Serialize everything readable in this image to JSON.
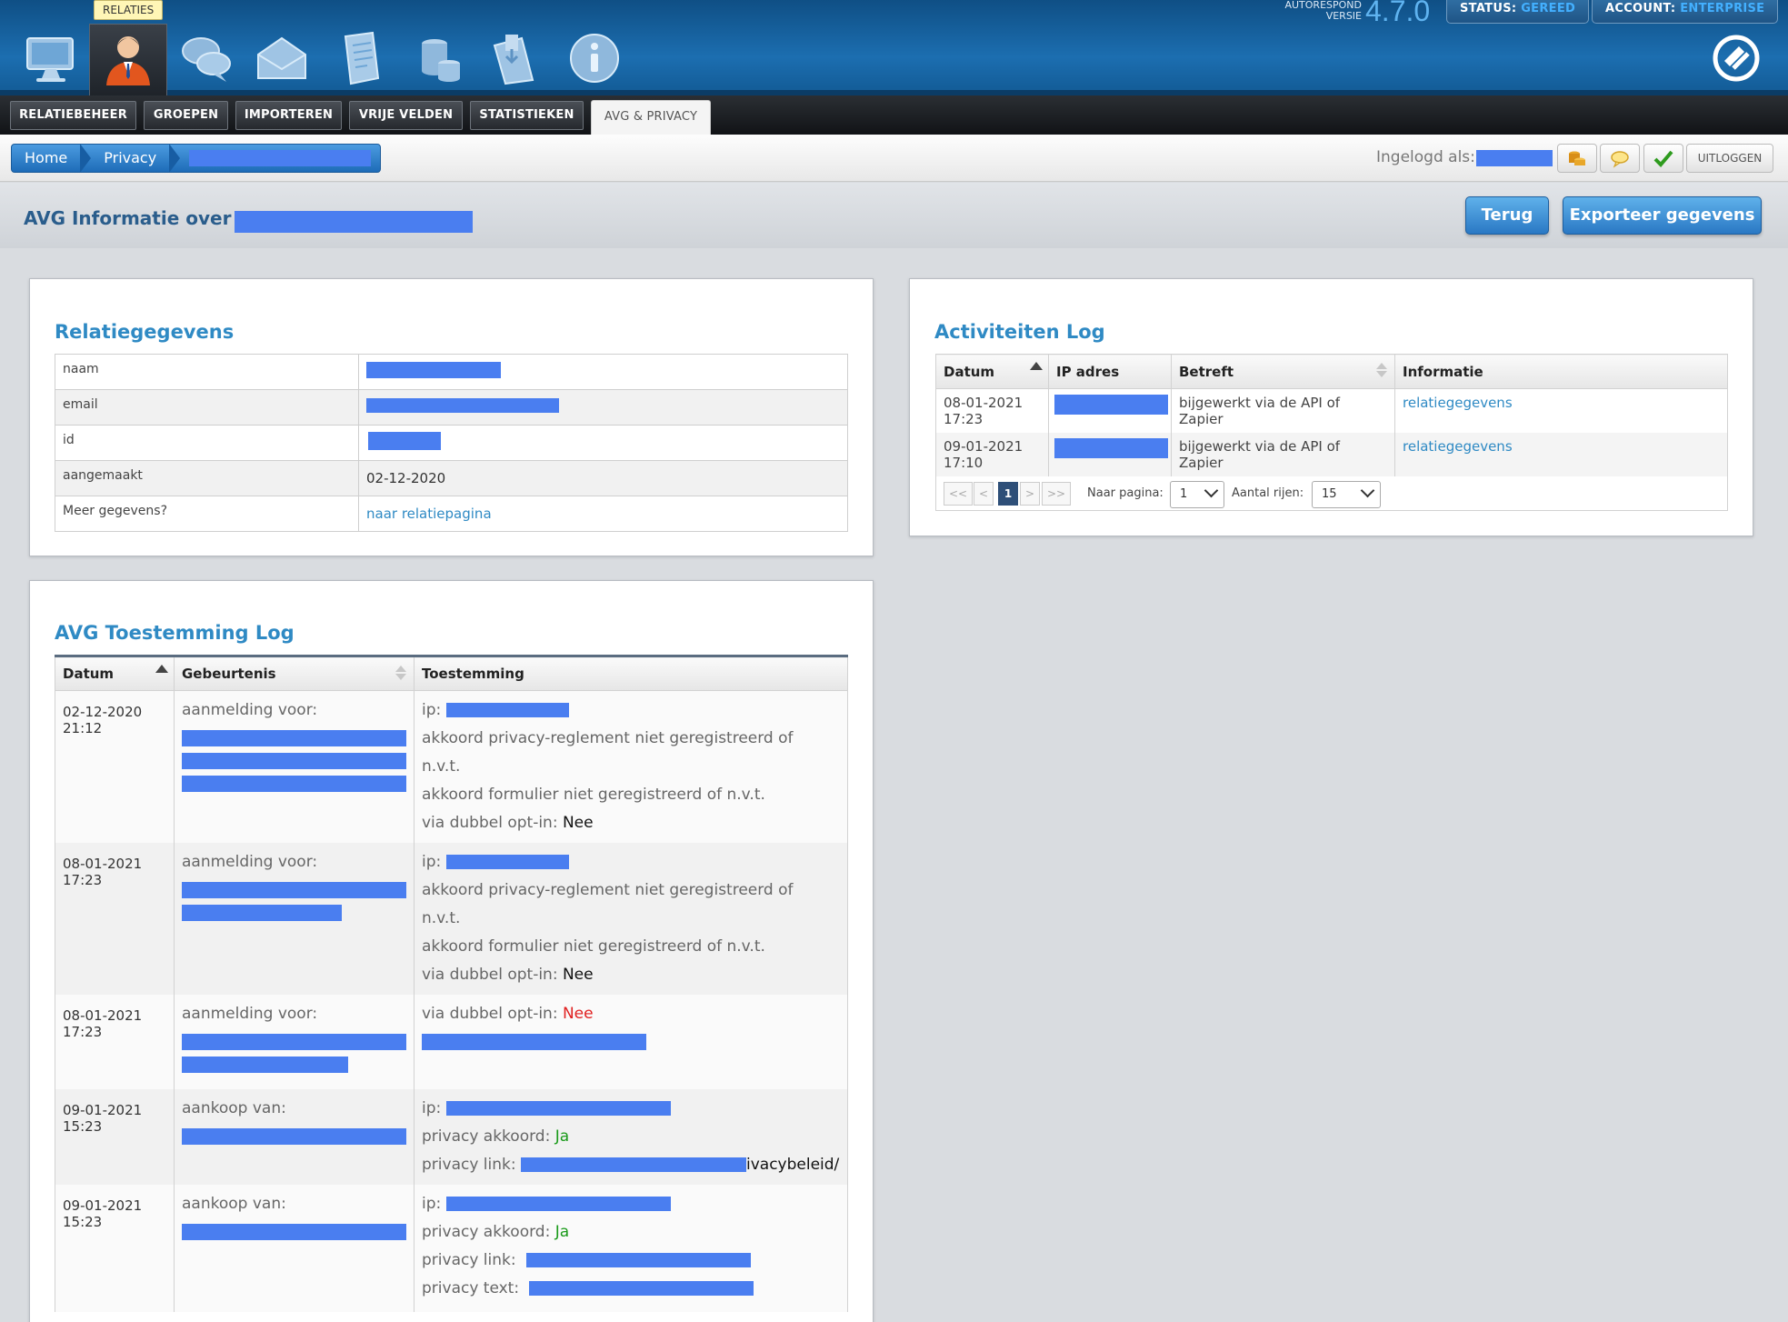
{
  "header": {
    "tooltip": "RELATIES",
    "version_label_1": "AUTORESPOND",
    "version_label_2": "VERSIE",
    "version_number": "4.7.0",
    "status_label": "STATUS:",
    "status_value": "GEREED",
    "account_label": "ACCOUNT:",
    "account_value": "ENTERPRISE",
    "nav_icons": [
      "monitor-icon",
      "user-icon",
      "chat-bubbles-icon",
      "envelope-icon",
      "document-icon",
      "coins-stack-icon",
      "save-disk-icon",
      "info-icon"
    ]
  },
  "tabs": [
    "RELATIEBEHEER",
    "GROEPEN",
    "IMPORTEREN",
    "VRIJE VELDEN",
    "STATISTIEKEN",
    "AVG & PRIVACY"
  ],
  "breadcrumb": {
    "home": "Home",
    "privacy": "Privacy"
  },
  "session": {
    "logged_in_label": "Ingelogd als:",
    "logout": "UITLOGGEN"
  },
  "page": {
    "title": "AVG Informatie over a",
    "back_button": "Terug",
    "export_button": "Exporteer gegevens"
  },
  "relatie": {
    "title": "Relatiegegevens",
    "rows": [
      {
        "key": "naam",
        "value": ""
      },
      {
        "key": "email",
        "value": ""
      },
      {
        "key": "id",
        "value": ""
      },
      {
        "key": "aangemaakt",
        "value": "02-12-2020"
      },
      {
        "key": "Meer gegevens?",
        "value": "naar relatiepagina"
      }
    ]
  },
  "activity": {
    "title": "Activiteiten Log",
    "columns": [
      "Datum",
      "IP adres",
      "Betreft",
      "Informatie"
    ],
    "rows": [
      {
        "date": "08-01-2021",
        "time": "17:23",
        "betreft": "bijgewerkt via de API of Zapier",
        "info": "relatiegegevens"
      },
      {
        "date": "09-01-2021",
        "time": "17:10",
        "betreft": "bijgewerkt via de API of Zapier",
        "info": "relatiegegevens"
      }
    ],
    "pager": {
      "first": "<<",
      "prev": "<",
      "current": "1",
      "next": ">",
      "last": ">>",
      "goto_label": "Naar pagina:",
      "goto_value": "1",
      "rows_label": "Aantal rijen:",
      "rows_value": "15"
    }
  },
  "consent": {
    "title": "AVG Toestemming Log",
    "columns": [
      "Datum",
      "Gebeurtenis",
      "Toestemming"
    ],
    "labels": {
      "aanmelding": "aanmelding voor:",
      "aankoop": "aankoop van:",
      "ip": "ip:",
      "privacy_reglement": "akkoord privacy-reglement niet geregistreerd of",
      "nvt": "n.v.t.",
      "formulier": "akkoord formulier niet geregistreerd of n.v.t.",
      "dubbel": "via dubbel opt-in:",
      "nee": "Nee",
      "privacy_akkoord": "privacy akkoord:",
      "ja": "Ja",
      "privacy_link": "privacy link:",
      "privacy_text": "privacy text:",
      "link_tail": "ivacybeleid/"
    },
    "rows": [
      {
        "date": "02-12-2020",
        "time": "21:12"
      },
      {
        "date": "08-01-2021",
        "time": "17:23"
      },
      {
        "date": "08-01-2021",
        "time": "17:23"
      },
      {
        "date": "09-01-2021",
        "time": "15:23"
      },
      {
        "date": "09-01-2021",
        "time": "15:23"
      }
    ]
  },
  "colors": {
    "accent": "#2f8ac4",
    "redaction": "#4a7ef0",
    "header_top": "#0f4f85",
    "negative": "#e02020",
    "positive": "#1a9a1a"
  }
}
